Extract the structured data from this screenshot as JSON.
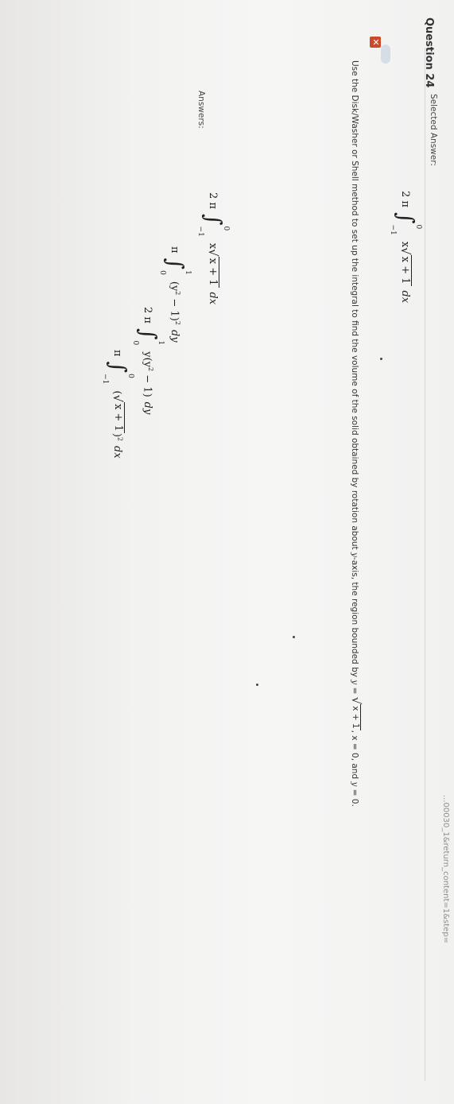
{
  "browser": {
    "url_fragment": "...00030_1&return_content=1&step="
  },
  "question": {
    "title": "Question 24",
    "status_icon": "incorrect-x-icon",
    "status_color": "#c94b29",
    "prompt_lead": "Use the Disk/Washer or Shell method to set up the integral to find the volume of the solid obtained by rotation about",
    "prompt_axis": "y",
    "prompt_mid": "-axis, the region bounded by",
    "prompt_curve_var": "y",
    "prompt_curve_eq": " = ",
    "prompt_curve_expr": "x + 1",
    "prompt_bound1": ", x = 0, and",
    "prompt_bound2_var": "y",
    "prompt_bound2": " = 0."
  },
  "selected_answer": {
    "label": "Selected Answer:",
    "coef": "2 π",
    "integral": "∫",
    "upper": "0",
    "lower": "−1",
    "integrand_x": "x",
    "radicand": "x + 1",
    "dx": "dx"
  },
  "answers": {
    "label": "Answers:",
    "items": [
      {
        "coef": "2 π",
        "integral": "∫",
        "upper": "0",
        "lower": "−1",
        "integrand_x": "x",
        "radicand": "x + 1",
        "dx": "dx"
      },
      {
        "coef": "π",
        "integral": "∫",
        "upper": "1",
        "lower": "0",
        "integrand": "(y",
        "exp1": "2",
        "integrand_tail": " − 1)",
        "exp2": "2",
        "dx": "dy"
      },
      {
        "coef": "2 π",
        "integral": "∫",
        "upper": "1",
        "lower": "0",
        "integrand": "y(y",
        "exp1": "2",
        "integrand_tail": " − 1)",
        "dx": "dy"
      },
      {
        "coef": "π",
        "integral": "∫",
        "upper": "0",
        "lower": "−1",
        "integrand_open": "(",
        "radicand": "x + 1",
        "integrand_close": ")",
        "exp2": "2",
        "dx": "dx"
      }
    ]
  }
}
